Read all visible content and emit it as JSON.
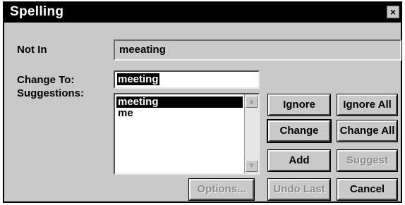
{
  "window": {
    "title": "Spelling",
    "close_glyph": "×"
  },
  "fields": {
    "not_in_label": "Not In",
    "not_in_value": "meeating",
    "change_to_label": "Change To:",
    "change_to_value": "meeting",
    "suggestions_label": "Suggestions:"
  },
  "suggestions": [
    "meeting",
    "me"
  ],
  "buttons": {
    "ignore": "Ignore",
    "ignore_all": "Ignore All",
    "change": "Change",
    "change_all": "Change All",
    "add": "Add",
    "suggest": "Suggest",
    "options": "Options...",
    "undo_last": "Undo Last",
    "cancel": "Cancel"
  },
  "icons": {
    "scroll_up": "arrow-up-icon",
    "scroll_down": "arrow-down-icon"
  }
}
